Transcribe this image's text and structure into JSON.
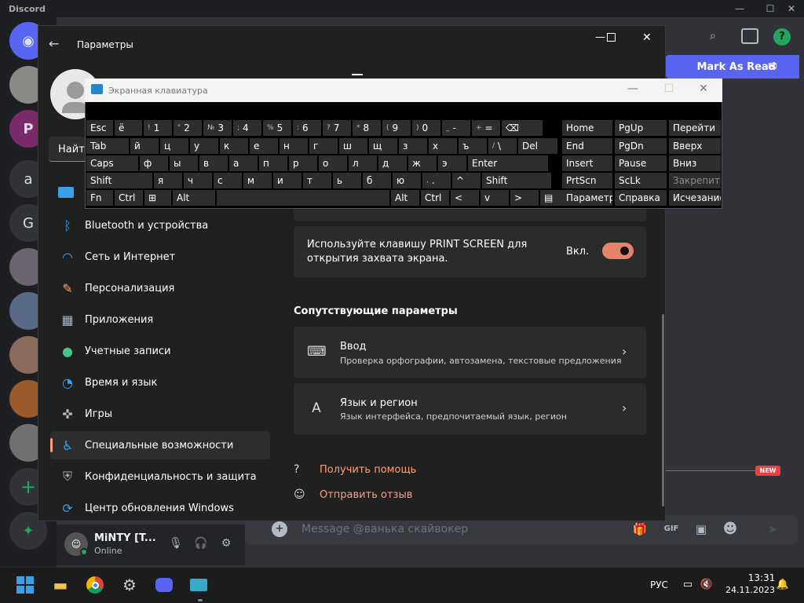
{
  "discord": {
    "title": "Discord",
    "mark_read": "Mark As Read",
    "new_badge": "NEW",
    "message_placeholder": "Message @ванька скайвокер",
    "user": {
      "name": "MiNTY [T...",
      "status": "Online"
    },
    "servers": [
      "a",
      "G"
    ],
    "accent": "#5865f2"
  },
  "settings": {
    "title": "Параметры",
    "search_value": "Найти",
    "nav": [
      "Bluetooth и устройства",
      "Сеть и Интернет",
      "Персонализация",
      "Приложения",
      "Учетные записи",
      "Время и язык",
      "Игры",
      "Специальные возможности",
      "Конфиденциальность и защита",
      "Центр обновления Windows"
    ],
    "print_screen_text": "Используйте клавишу PRINT SCREEN для открытия захвата экрана.",
    "print_screen_state": "Вкл.",
    "related_heading": "Сопутствующие параметры",
    "input_title": "Ввод",
    "input_sub": "Проверка орфографии, автозамена, текстовые предложения",
    "lang_title": "Язык и регион",
    "lang_sub": "Язык интерфейса, предпочитаемый язык, регион",
    "help_link": "Получить помощь",
    "feedback_link": "Отправить отзыв",
    "accent": "#ff9f7a"
  },
  "osk": {
    "title": "Экранная клавиатура",
    "rows": [
      [
        {
          "t": "Esc"
        },
        {
          "t": "ё"
        },
        {
          "s": "!",
          "t": "1"
        },
        {
          "s": "\"",
          "t": "2"
        },
        {
          "s": "№",
          "t": "3"
        },
        {
          "s": ";",
          "t": "4"
        },
        {
          "s": "%",
          "t": "5"
        },
        {
          "s": ":",
          "t": "6"
        },
        {
          "s": "?",
          "t": "7"
        },
        {
          "s": "*",
          "t": "8"
        },
        {
          "s": "(",
          "t": "9"
        },
        {
          "s": ")",
          "t": "0"
        },
        {
          "s": "_",
          "t": "-"
        },
        {
          "s": "+",
          "t": "="
        },
        {
          "t": "⌫"
        }
      ],
      [
        {
          "t": "Tab"
        },
        {
          "t": "й"
        },
        {
          "t": "ц"
        },
        {
          "t": "у"
        },
        {
          "t": "к"
        },
        {
          "t": "е"
        },
        {
          "t": "н"
        },
        {
          "t": "г"
        },
        {
          "t": "ш"
        },
        {
          "t": "щ"
        },
        {
          "t": "з"
        },
        {
          "t": "х"
        },
        {
          "t": "ъ"
        },
        {
          "s": "/",
          "t": "\\"
        },
        {
          "t": "Del"
        }
      ],
      [
        {
          "t": "Caps"
        },
        {
          "t": "ф"
        },
        {
          "t": "ы"
        },
        {
          "t": "в"
        },
        {
          "t": "а"
        },
        {
          "t": "п"
        },
        {
          "t": "р"
        },
        {
          "t": "о"
        },
        {
          "t": "л"
        },
        {
          "t": "д"
        },
        {
          "t": "ж"
        },
        {
          "t": "э"
        },
        {
          "t": "Enter"
        }
      ],
      [
        {
          "t": "Shift"
        },
        {
          "t": "я"
        },
        {
          "t": "ч"
        },
        {
          "t": "с"
        },
        {
          "t": "м"
        },
        {
          "t": "и"
        },
        {
          "t": "т"
        },
        {
          "t": "ь"
        },
        {
          "t": "б"
        },
        {
          "t": "ю"
        },
        {
          "s": ",",
          "t": "."
        },
        {
          "t": "^"
        },
        {
          "t": "Shift"
        }
      ],
      [
        {
          "t": "Fn"
        },
        {
          "t": "Ctrl"
        },
        {
          "t": "⊞"
        },
        {
          "t": "Alt"
        },
        {
          "t": ""
        },
        {
          "t": "Alt"
        },
        {
          "t": "Ctrl"
        },
        {
          "t": "<"
        },
        {
          "t": "v"
        },
        {
          "t": ">"
        },
        {
          "t": "▤"
        }
      ]
    ],
    "nav": [
      [
        "Home",
        "PgUp",
        "Перейти"
      ],
      [
        "End",
        "PgDn",
        "Вверх"
      ],
      [
        "Insert",
        "Pause",
        "Вниз"
      ],
      [
        "PrtScn",
        "ScLk",
        "Закрепить"
      ],
      [
        "Параметры",
        "Справка",
        "Исчезание"
      ]
    ]
  },
  "taskbar": {
    "lang": "РУС",
    "time": "13:31",
    "date": "24.11.2023"
  }
}
